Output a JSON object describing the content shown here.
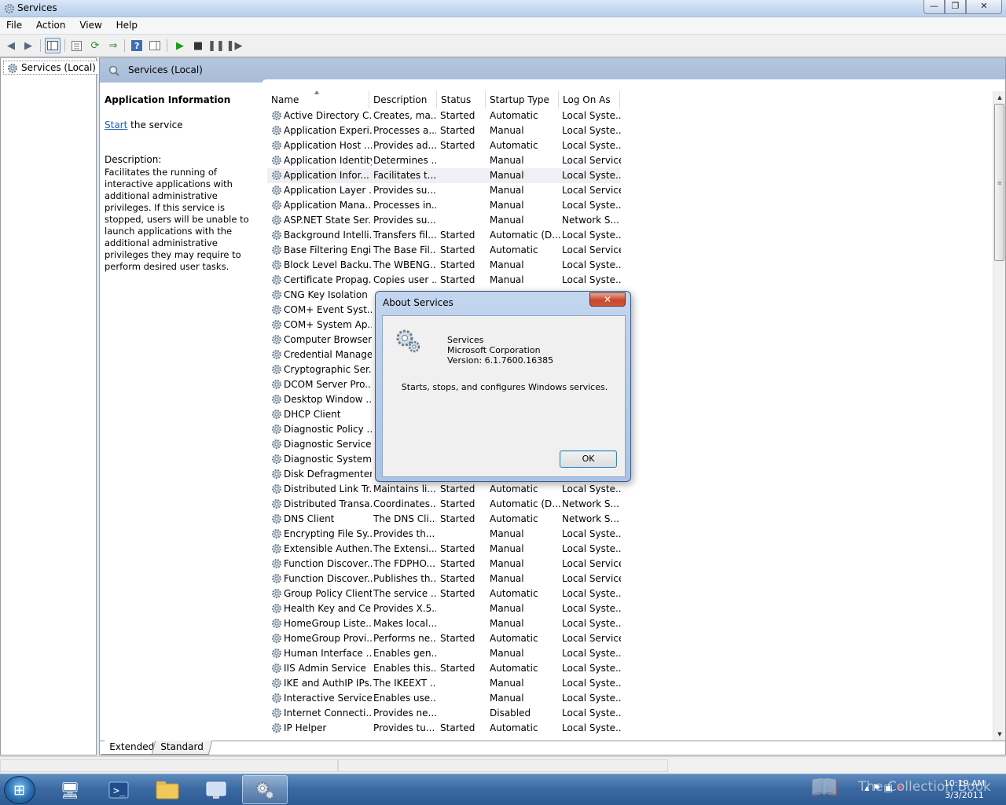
{
  "window": {
    "title": "Services",
    "min": "—",
    "max": "❐",
    "close": "✕"
  },
  "menu": [
    "File",
    "Action",
    "View",
    "Help"
  ],
  "tree": {
    "root_label": "Services (Local)"
  },
  "header": {
    "title": "Services (Local)"
  },
  "info": {
    "title": "Application Information",
    "action_link": "Start",
    "action_rest": " the service",
    "desc_label": "Description:",
    "desc_text": "Facilitates the running of interactive applications with additional administrative privileges.  If this service is stopped, users will be unable to launch applications with the additional administrative privileges they may require to perform desired user tasks."
  },
  "columns": {
    "name": "Name",
    "description": "Description",
    "status": "Status",
    "startup": "Startup Type",
    "logon": "Log On As"
  },
  "services": [
    {
      "name": "Active Directory C...",
      "desc": "Creates, ma...",
      "status": "Started",
      "startup": "Automatic",
      "logon": "Local Syste..."
    },
    {
      "name": "Application Experi...",
      "desc": "Processes a...",
      "status": "Started",
      "startup": "Manual",
      "logon": "Local Syste..."
    },
    {
      "name": "Application Host ...",
      "desc": "Provides ad...",
      "status": "Started",
      "startup": "Automatic",
      "logon": "Local Syste..."
    },
    {
      "name": "Application Identity",
      "desc": "Determines ...",
      "status": "",
      "startup": "Manual",
      "logon": "Local Service"
    },
    {
      "name": "Application Infor...",
      "desc": "Facilitates t...",
      "status": "",
      "startup": "Manual",
      "logon": "Local Syste...",
      "selected": true
    },
    {
      "name": "Application Layer ...",
      "desc": "Provides su...",
      "status": "",
      "startup": "Manual",
      "logon": "Local Service"
    },
    {
      "name": "Application Mana...",
      "desc": "Processes in...",
      "status": "",
      "startup": "Manual",
      "logon": "Local Syste..."
    },
    {
      "name": "ASP.NET State Ser...",
      "desc": "Provides su...",
      "status": "",
      "startup": "Manual",
      "logon": "Network S..."
    },
    {
      "name": "Background Intelli...",
      "desc": "Transfers fil...",
      "status": "Started",
      "startup": "Automatic (D...",
      "logon": "Local Syste..."
    },
    {
      "name": "Base Filtering Engi...",
      "desc": "The Base Fil...",
      "status": "Started",
      "startup": "Automatic",
      "logon": "Local Service"
    },
    {
      "name": "Block Level Backu...",
      "desc": "The WBENG...",
      "status": "Started",
      "startup": "Manual",
      "logon": "Local Syste..."
    },
    {
      "name": "Certificate Propag...",
      "desc": "Copies user ...",
      "status": "Started",
      "startup": "Manual",
      "logon": "Local Syste..."
    },
    {
      "name": "CNG Key Isolation",
      "desc": "",
      "status": "",
      "startup": "",
      "logon": ""
    },
    {
      "name": "COM+ Event Syst...",
      "desc": "",
      "status": "",
      "startup": "",
      "logon": ""
    },
    {
      "name": "COM+ System Ap...",
      "desc": "",
      "status": "",
      "startup": "",
      "logon": ""
    },
    {
      "name": "Computer Browser",
      "desc": "",
      "status": "",
      "startup": "",
      "logon": ""
    },
    {
      "name": "Credential Manager",
      "desc": "",
      "status": "",
      "startup": "",
      "logon": ""
    },
    {
      "name": "Cryptographic Ser...",
      "desc": "",
      "status": "",
      "startup": "",
      "logon": ""
    },
    {
      "name": "DCOM Server Pro...",
      "desc": "",
      "status": "",
      "startup": "",
      "logon": ""
    },
    {
      "name": "Desktop Window ...",
      "desc": "",
      "status": "",
      "startup": "",
      "logon": ""
    },
    {
      "name": "DHCP Client",
      "desc": "",
      "status": "",
      "startup": "",
      "logon": ""
    },
    {
      "name": "Diagnostic Policy ...",
      "desc": "",
      "status": "",
      "startup": "",
      "logon": ""
    },
    {
      "name": "Diagnostic Service...",
      "desc": "",
      "status": "",
      "startup": "",
      "logon": ""
    },
    {
      "name": "Diagnostic System...",
      "desc": "",
      "status": "",
      "startup": "",
      "logon": ""
    },
    {
      "name": "Disk Defragmenter",
      "desc": "",
      "status": "",
      "startup": "",
      "logon": ""
    },
    {
      "name": "Distributed Link Tr...",
      "desc": "Maintains li...",
      "status": "Started",
      "startup": "Automatic",
      "logon": "Local Syste..."
    },
    {
      "name": "Distributed Transa...",
      "desc": "Coordinates...",
      "status": "Started",
      "startup": "Automatic (D...",
      "logon": "Network S..."
    },
    {
      "name": "DNS Client",
      "desc": "The DNS Cli...",
      "status": "Started",
      "startup": "Automatic",
      "logon": "Network S..."
    },
    {
      "name": "Encrypting File Sy...",
      "desc": "Provides th...",
      "status": "",
      "startup": "Manual",
      "logon": "Local Syste..."
    },
    {
      "name": "Extensible Authen...",
      "desc": "The Extensi...",
      "status": "Started",
      "startup": "Manual",
      "logon": "Local Syste..."
    },
    {
      "name": "Function Discover...",
      "desc": "The FDPHO...",
      "status": "Started",
      "startup": "Manual",
      "logon": "Local Service"
    },
    {
      "name": "Function Discover...",
      "desc": "Publishes th...",
      "status": "Started",
      "startup": "Manual",
      "logon": "Local Service"
    },
    {
      "name": "Group Policy Client",
      "desc": "The service ...",
      "status": "Started",
      "startup": "Automatic",
      "logon": "Local Syste..."
    },
    {
      "name": "Health Key and Ce...",
      "desc": "Provides X.5...",
      "status": "",
      "startup": "Manual",
      "logon": "Local Syste..."
    },
    {
      "name": "HomeGroup Liste...",
      "desc": "Makes local...",
      "status": "",
      "startup": "Manual",
      "logon": "Local Syste..."
    },
    {
      "name": "HomeGroup Provi...",
      "desc": "Performs ne...",
      "status": "Started",
      "startup": "Automatic",
      "logon": "Local Service"
    },
    {
      "name": "Human Interface ...",
      "desc": "Enables gen...",
      "status": "",
      "startup": "Manual",
      "logon": "Local Syste..."
    },
    {
      "name": "IIS Admin Service",
      "desc": "Enables this...",
      "status": "Started",
      "startup": "Automatic",
      "logon": "Local Syste..."
    },
    {
      "name": "IKE and AuthIP IPs...",
      "desc": "The IKEEXT ...",
      "status": "",
      "startup": "Manual",
      "logon": "Local Syste..."
    },
    {
      "name": "Interactive Service...",
      "desc": "Enables use...",
      "status": "",
      "startup": "Manual",
      "logon": "Local Syste..."
    },
    {
      "name": "Internet Connecti...",
      "desc": "Provides ne...",
      "status": "",
      "startup": "Disabled",
      "logon": "Local Syste..."
    },
    {
      "name": "IP Helper",
      "desc": "Provides tu...",
      "status": "Started",
      "startup": "Automatic",
      "logon": "Local Syste..."
    }
  ],
  "tabs": [
    "Extended",
    "Standard"
  ],
  "dialog": {
    "title": "About Services",
    "app_name": "Services",
    "company": "Microsoft Corporation",
    "version": "Version: 6.1.7600.16385",
    "message": "Starts, stops, and configures Windows services.",
    "ok": "OK",
    "close": "✕"
  },
  "taskbar": {
    "clock_time": "10:19 AM",
    "clock_date": "3/3/2011",
    "watermark": "The Collection Book"
  }
}
